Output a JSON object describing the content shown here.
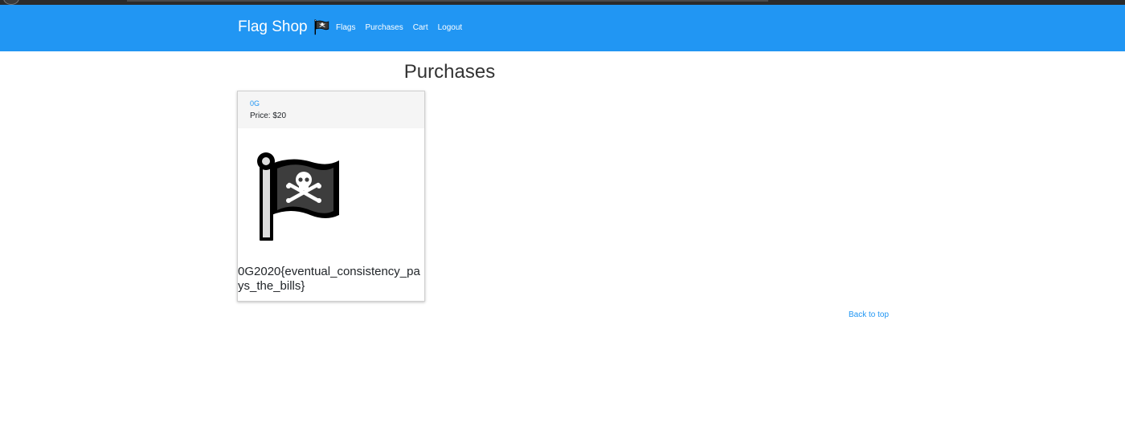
{
  "navbar": {
    "brand": "Flag Shop",
    "brand_icon": "pirate-flag-icon",
    "background": "#2196f3",
    "links": [
      {
        "label": "Flags"
      },
      {
        "label": "Purchases"
      },
      {
        "label": "Cart"
      },
      {
        "label": "Logout"
      }
    ]
  },
  "page": {
    "title": "Purchases"
  },
  "purchases": [
    {
      "name": "0G",
      "price": "Price: $20",
      "image_icon": "pirate-flag-icon",
      "flag_text": "0G2020{eventual_consistency_pays_the_bills}"
    }
  ],
  "footer": {
    "back_to_top": "Back to top"
  },
  "colors": {
    "accent": "#2196f3",
    "card_header": "#f5f5f5"
  }
}
